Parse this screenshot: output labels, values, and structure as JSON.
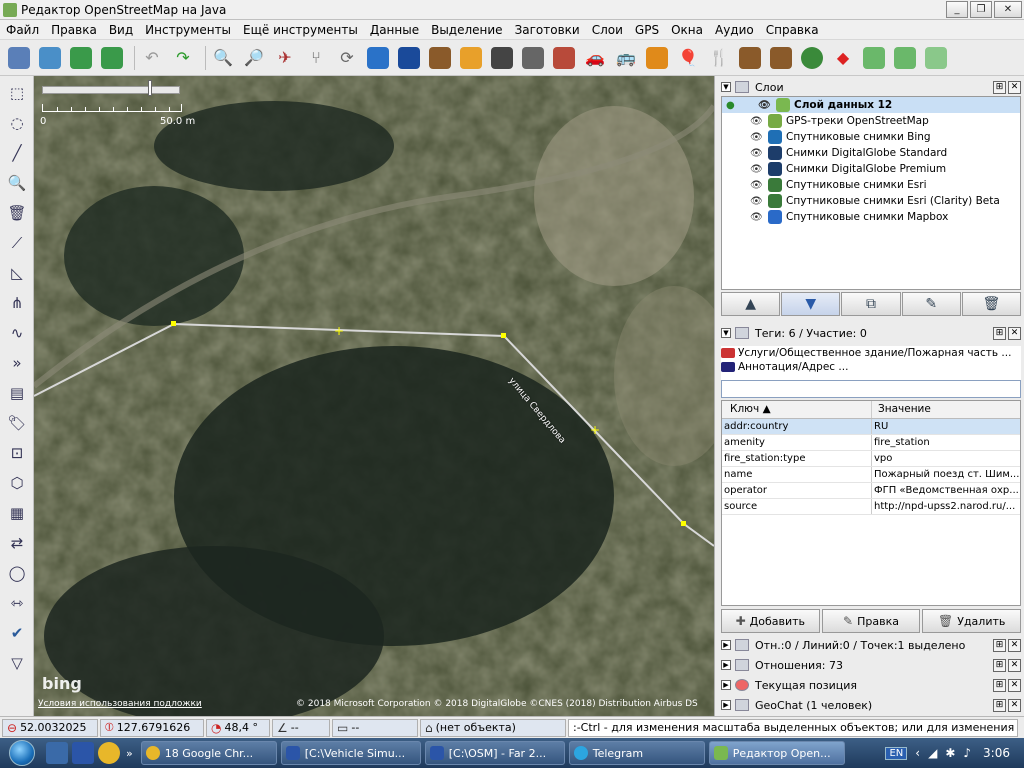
{
  "window": {
    "title": "Редактор OpenStreetMap на Java",
    "min": "_",
    "max": "❐",
    "close": "✕"
  },
  "menu": [
    "Файл",
    "Правка",
    "Вид",
    "Инструменты",
    "Ещё инструменты",
    "Данные",
    "Выделение",
    "Заготовки",
    "Слои",
    "GPS",
    "Окна",
    "Аудио",
    "Справка"
  ],
  "toolbar_icons": [
    "open-file-icon",
    "download-icon",
    "download-arrow-icon",
    "upload-icon",
    "undo-icon",
    "redo-icon",
    "zoom-data-icon",
    "search-icon",
    "gpx-icon",
    "split-icon",
    "refresh-icon",
    "river-icon",
    "water-icon",
    "railway-icon",
    "road-icon",
    "track-icon",
    "stop-icon",
    "wall-icon",
    "car-icon",
    "bus-icon",
    "warning-icon",
    "balloons-icon",
    "restaurant-icon",
    "castle-icon",
    "factory-icon",
    "tree-icon",
    "poi-icon",
    "import-icon",
    "export-icon",
    "expand-icon"
  ],
  "left_tools": [
    "select-tool",
    "lasso-tool",
    "draw-tool",
    "zoom-tool",
    "delete-tool",
    "improve-tool",
    "parallel-tool",
    "split-way-tool",
    "connect-tool",
    "more-tools",
    "layer-tool",
    "tag-tool",
    "node-tool",
    "area-tool",
    "align-tool",
    "combine-tool",
    "circle-tool",
    "mirror-tool",
    "validate-tool",
    "filter-tool"
  ],
  "map": {
    "scale_start": "0",
    "scale_end": "50.0 m",
    "street_label": "улица Свердлова",
    "bing_logo": "bing",
    "terms": "Условия использования подложки",
    "credits": "© 2018 Microsoft Corporation © 2018 DigitalGlobe ©CNES (2018) Distribution Airbus DS"
  },
  "layers_panel": {
    "title": "Слои",
    "layers": [
      {
        "name": "Слой данных 12",
        "selected": true,
        "active": true,
        "icon_color": "#7ab850"
      },
      {
        "name": "GPS-треки OpenStreetMap",
        "selected": false,
        "active": false,
        "icon_color": "#77aa44"
      },
      {
        "name": "Спутниковые снимки Bing",
        "selected": false,
        "active": false,
        "icon_color": "#1f6fb5"
      },
      {
        "name": "Снимки DigitalGlobe Standard",
        "selected": false,
        "active": false,
        "icon_color": "#1d3d6a"
      },
      {
        "name": "Снимки DigitalGlobe Premium",
        "selected": false,
        "active": false,
        "icon_color": "#1d3d6a"
      },
      {
        "name": "Спутниковые снимки Esri",
        "selected": false,
        "active": false,
        "icon_color": "#3a7a3a"
      },
      {
        "name": "Спутниковые снимки Esri (Clarity) Beta",
        "selected": false,
        "active": false,
        "icon_color": "#3a7a3a"
      },
      {
        "name": "Спутниковые снимки Mapbox",
        "selected": false,
        "active": false,
        "icon_color": "#2a6ac8"
      }
    ]
  },
  "tags_panel": {
    "title": "Теги: 6 / Участие: 0",
    "presets": [
      "Услуги/Общественное здание/Пожарная часть ...",
      "Аннотация/Адрес ..."
    ],
    "col_key": "Ключ",
    "col_value": "Значение",
    "rows": [
      {
        "key": "addr:country",
        "value": "RU",
        "selected": true
      },
      {
        "key": "amenity",
        "value": "fire_station",
        "selected": false
      },
      {
        "key": "fire_station:type",
        "value": "vpo",
        "selected": false
      },
      {
        "key": "name",
        "value": "Пожарный поезд ст. Шим...",
        "selected": false
      },
      {
        "key": "operator",
        "value": "ФГП «Ведомственная охр...",
        "selected": false
      },
      {
        "key": "source",
        "value": "http://npd-upss2.narod.ru/...",
        "selected": false
      }
    ],
    "btn_add": "Добавить",
    "btn_edit": "Правка",
    "btn_delete": "Удалить"
  },
  "collapsed_panels": [
    {
      "name": "selection",
      "label": "Отн.:0 / Линий:0 / Точек:1 выделено"
    },
    {
      "name": "relations",
      "label": "Отношения: 73"
    },
    {
      "name": "position",
      "label": "Текущая позиция"
    },
    {
      "name": "geochat",
      "label": "GeoChat (1 человек)"
    }
  ],
  "status": {
    "lat": "52.0032025",
    "lon": "127.6791626",
    "heading": "48,4 °",
    "angle": "--",
    "length": "--",
    "object": "(нет объекта)",
    "help": ":-Ctrl - для изменения масштаба выделенных объектов; или для изменения выделения"
  },
  "taskbar": {
    "tasks": [
      {
        "label": "18 Google Chr...",
        "color": "#e8b72a",
        "active": false
      },
      {
        "label": "[C:\\Vehicle Simu...",
        "color": "#2b55a8",
        "active": false
      },
      {
        "label": "[C:\\OSM] - Far 2...",
        "color": "#2b55a8",
        "active": false
      },
      {
        "label": "Telegram",
        "color": "#2ca5e0",
        "active": false
      },
      {
        "label": "Редактор Open...",
        "color": "#7ab850",
        "active": true
      }
    ],
    "lang": "EN",
    "clock": "3:06"
  }
}
